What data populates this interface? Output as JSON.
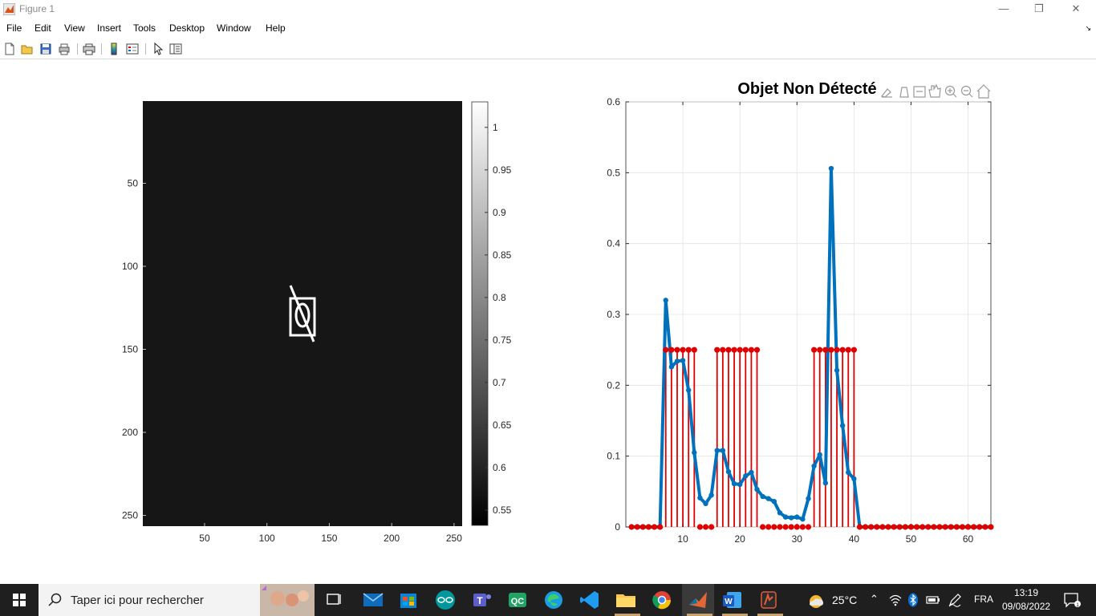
{
  "window": {
    "title": "Figure 1",
    "controls": {
      "minimize": "—",
      "maximize": "❐",
      "close": "✕"
    }
  },
  "menu": {
    "items": [
      "File",
      "Edit",
      "View",
      "Insert",
      "Tools",
      "Desktop",
      "Window",
      "Help"
    ]
  },
  "toolbar": {
    "buttons": [
      "new-figure",
      "open-file",
      "save-figure",
      "print-figure",
      "print-preview",
      "insert-colorbar",
      "insert-legend",
      "edit-plot",
      "open-property-inspector"
    ]
  },
  "image_axes": {
    "xticks": [
      "50",
      "100",
      "150",
      "200",
      "250"
    ],
    "yticks": [
      "50",
      "100",
      "150",
      "200",
      "250"
    ],
    "colorbar_ticks": [
      "1",
      "0.95",
      "0.9",
      "0.85",
      "0.8",
      "0.75",
      "0.7",
      "0.65",
      "0.6",
      "0.55"
    ],
    "background_color": "#161616"
  },
  "axes_toolbar": {
    "buttons": [
      "brush-icon",
      "data-tips-icon",
      "export-icon",
      "pan-icon",
      "zoom-in-icon",
      "zoom-out-icon",
      "home-icon"
    ]
  },
  "chart_data": {
    "type": "line",
    "title": "Objet Non Détecté",
    "xlim": [
      0,
      64
    ],
    "ylim": [
      0,
      0.6
    ],
    "xticks": [
      "10",
      "20",
      "30",
      "40",
      "50",
      "60"
    ],
    "yticks": [
      "0",
      "0.1",
      "0.2",
      "0.3",
      "0.4",
      "0.5",
      "0.6"
    ],
    "grid": true,
    "series": [
      {
        "type": "line",
        "color": "#0072BD",
        "x": [
          1,
          2,
          3,
          4,
          5,
          6,
          7,
          8,
          9,
          10,
          11,
          12,
          13,
          14,
          15,
          16,
          17,
          18,
          19,
          20,
          21,
          22,
          23,
          24,
          25,
          26,
          27,
          28,
          29,
          30,
          31,
          32,
          33,
          34,
          35,
          36,
          37,
          38,
          39,
          40,
          41,
          42,
          43,
          44,
          45,
          46,
          47,
          48,
          49,
          50,
          51,
          52,
          53,
          54,
          55,
          56,
          57,
          58,
          59,
          60,
          61,
          62,
          63,
          64
        ],
        "y": [
          0,
          0,
          0,
          0,
          0,
          0,
          0.32,
          0.226,
          0.234,
          0.235,
          0.193,
          0.105,
          0.041,
          0.033,
          0.045,
          0.108,
          0.108,
          0.078,
          0.061,
          0.06,
          0.072,
          0.077,
          0.053,
          0.043,
          0.04,
          0.036,
          0.02,
          0.014,
          0.013,
          0.014,
          0.011,
          0.04,
          0.086,
          0.102,
          0.062,
          0.506,
          0.221,
          0.143,
          0.077,
          0.068,
          0,
          0,
          0,
          0,
          0,
          0,
          0,
          0,
          0,
          0,
          0,
          0,
          0,
          0,
          0,
          0,
          0,
          0,
          0,
          0,
          0,
          0,
          0,
          0
        ]
      },
      {
        "type": "stem",
        "color": "#E00000",
        "x": [
          1,
          2,
          3,
          4,
          5,
          6,
          7,
          8,
          9,
          10,
          11,
          12,
          13,
          14,
          15,
          16,
          17,
          18,
          19,
          20,
          21,
          22,
          23,
          24,
          25,
          26,
          27,
          28,
          29,
          30,
          31,
          32,
          33,
          34,
          35,
          36,
          37,
          38,
          39,
          40,
          41,
          42,
          43,
          44,
          45,
          46,
          47,
          48,
          49,
          50,
          51,
          52,
          53,
          54,
          55,
          56,
          57,
          58,
          59,
          60,
          61,
          62,
          63,
          64
        ],
        "y": [
          0,
          0,
          0,
          0,
          0,
          0,
          0.25,
          0.25,
          0.25,
          0.25,
          0.25,
          0.25,
          0,
          0,
          0,
          0.25,
          0.25,
          0.25,
          0.25,
          0.25,
          0.25,
          0.25,
          0.25,
          0,
          0,
          0,
          0,
          0,
          0,
          0,
          0,
          0,
          0.25,
          0.25,
          0.25,
          0.25,
          0.25,
          0.25,
          0.25,
          0.25,
          0,
          0,
          0,
          0,
          0,
          0,
          0,
          0,
          0,
          0,
          0,
          0,
          0,
          0,
          0,
          0,
          0,
          0,
          0,
          0,
          0,
          0,
          0,
          0
        ]
      }
    ]
  },
  "taskbar": {
    "search_placeholder": "Taper ici pour rechercher",
    "apps": [
      "task-view-icon",
      "mail-icon",
      "store-icon",
      "arduino-icon",
      "teams-icon",
      "qc-icon",
      "edge-icon",
      "vscode-icon",
      "explorer-icon",
      "chrome-icon",
      "matlab-icon",
      "word-icon",
      "app-icon"
    ],
    "weather": "25°C",
    "language": "FRA",
    "time": "13:19",
    "date": "09/08/2022"
  }
}
